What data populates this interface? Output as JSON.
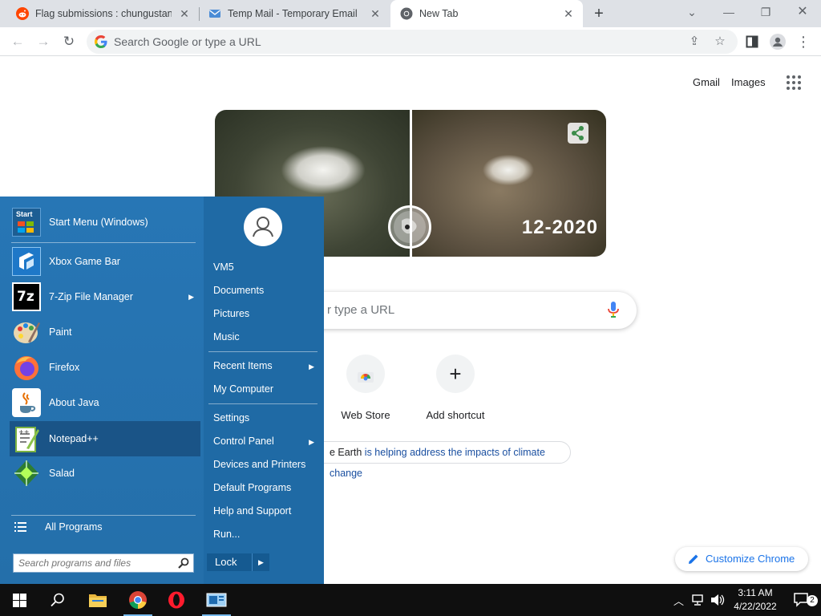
{
  "browser": {
    "tabs": [
      {
        "title": "Flag submissions : chungustan",
        "active": false
      },
      {
        "title": "Temp Mail - Temporary Email",
        "active": false
      },
      {
        "title": "New Tab",
        "active": true
      }
    ],
    "omnibox_placeholder": "Search Google or type a URL"
  },
  "ntp": {
    "links": {
      "gmail": "Gmail",
      "images": "Images"
    },
    "doodle_date": "12-2020",
    "search_placeholder": "r type a URL",
    "shortcuts": [
      {
        "label": "Web Store"
      },
      {
        "label": "Add shortcut"
      }
    ],
    "earth_prefix": "e Earth",
    "earth_link": "is helping address the impacts of climate change",
    "customize_label": "Customize Chrome"
  },
  "start_menu": {
    "programs": [
      {
        "label": "Start Menu (Windows)",
        "icon": "start-menu-icon"
      },
      {
        "label": "Xbox Game Bar",
        "icon": "xbox-icon"
      },
      {
        "label": "7-Zip File Manager",
        "icon": "7zip-icon",
        "submenu": true
      },
      {
        "label": "Paint",
        "icon": "paint-icon"
      },
      {
        "label": "Firefox",
        "icon": "firefox-icon"
      },
      {
        "label": "About Java",
        "icon": "java-icon"
      },
      {
        "label": "Notepad++",
        "icon": "notepad-icon",
        "highlighted": true
      },
      {
        "label": "Salad",
        "icon": "salad-icon"
      }
    ],
    "all_programs": "All Programs",
    "search_placeholder": "Search programs and files",
    "start_icon_text": "Start",
    "right": {
      "user": "VM5",
      "items_a": [
        "Documents",
        "Pictures",
        "Music"
      ],
      "recent_items": "Recent Items",
      "my_computer": "My Computer",
      "settings": "Settings",
      "control_panel": "Control Panel",
      "items_b": [
        "Devices and Printers",
        "Default Programs",
        "Help and Support",
        "Run..."
      ]
    },
    "lock_label": "Lock"
  },
  "taskbar": {
    "time": "3:11 AM",
    "date": "4/22/2022",
    "notifications": "2"
  },
  "colors": {
    "start_menu_bg": "#2776b5",
    "taskbar": "#0f0f0f",
    "chrome_blue": "#1a73e8"
  }
}
